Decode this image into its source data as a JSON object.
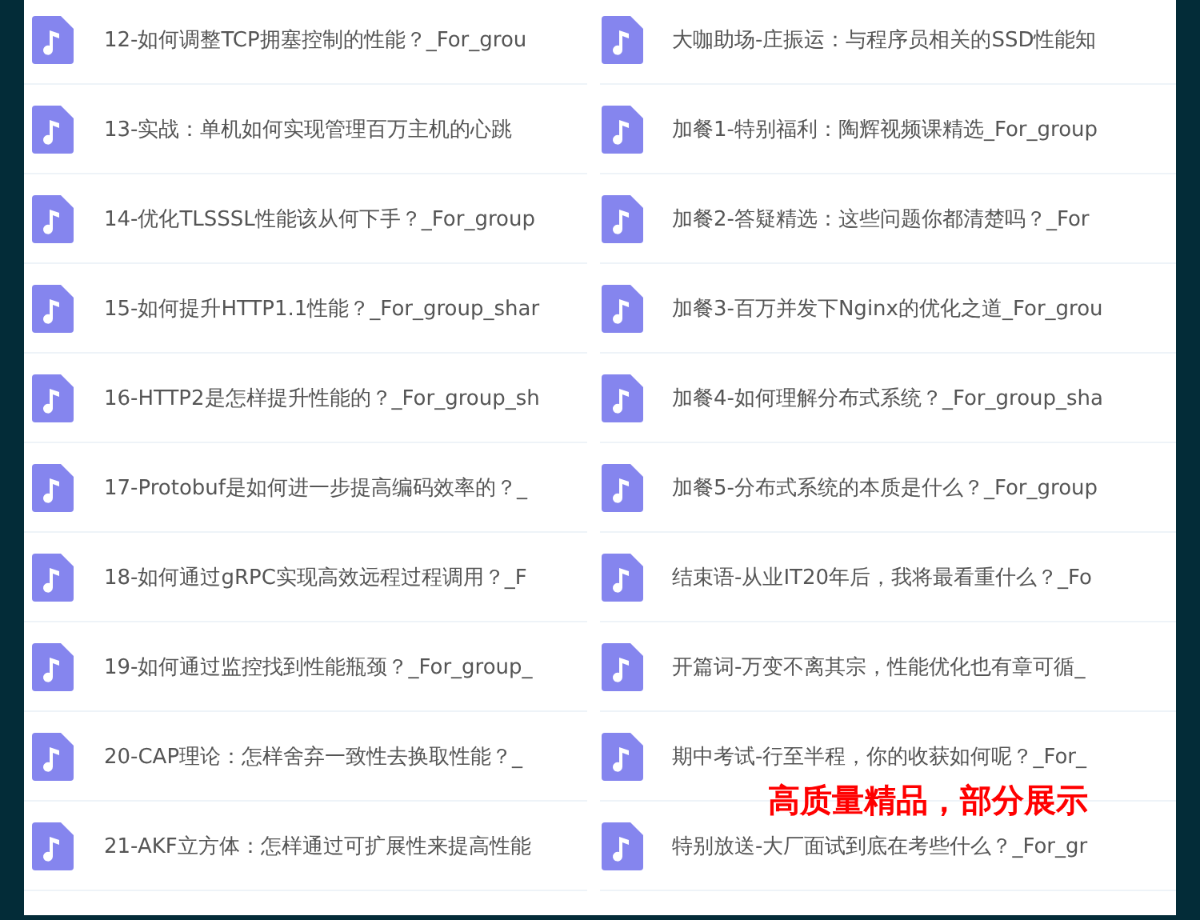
{
  "columns": [
    {
      "files": [
        {
          "name": "12-如何调整TCP拥塞控制的性能？_For_grou"
        },
        {
          "name": "13-实战：单机如何实现管理百万主机的心跳"
        },
        {
          "name": "14-优化TLSSSL性能该从何下手？_For_group"
        },
        {
          "name": "15-如何提升HTTP1.1性能？_For_group_shar"
        },
        {
          "name": "16-HTTP2是怎样提升性能的？_For_group_sh"
        },
        {
          "name": "17-Protobuf是如何进一步提高编码效率的？_"
        },
        {
          "name": "18-如何通过gRPC实现高效远程过程调用？_F"
        },
        {
          "name": "19-如何通过监控找到性能瓶颈？_For_group_"
        },
        {
          "name": "20-CAP理论：怎样舍弃一致性去换取性能？_"
        },
        {
          "name": "21-AKF立方体：怎样通过可扩展性来提高性能"
        }
      ]
    },
    {
      "files": [
        {
          "name": "大咖助场-庄振运：与程序员相关的SSD性能知"
        },
        {
          "name": "加餐1-特别福利：陶辉视频课精选_For_group"
        },
        {
          "name": "加餐2-答疑精选：这些问题你都清楚吗？_For"
        },
        {
          "name": "加餐3-百万并发下Nginx的优化之道_For_grou"
        },
        {
          "name": "加餐4-如何理解分布式系统？_For_group_sha"
        },
        {
          "name": "加餐5-分布式系统的本质是什么？_For_group"
        },
        {
          "name": "结束语-从业IT20年后，我将最看重什么？_Fo"
        },
        {
          "name": "开篇词-万变不离其宗，性能优化也有章可循_"
        },
        {
          "name": "期中考试-行至半程，你的收获如何呢？_For_"
        },
        {
          "name": "特别放送-大厂面试到底在考些什么？_For_gr"
        }
      ]
    }
  ],
  "banner": "高质量精品，部分展示"
}
